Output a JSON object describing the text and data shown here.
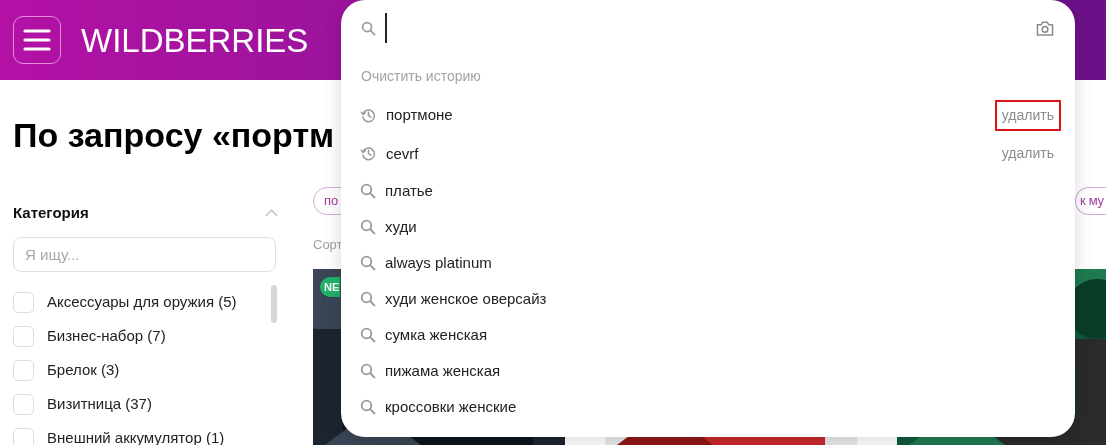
{
  "header": {
    "logo": "WILDBERRIES"
  },
  "page_title": "По запросу «портм",
  "filters": {
    "title": "Категория",
    "expanded": true,
    "search": {
      "placeholder": "Я ищу..."
    },
    "items": [
      {
        "label": "Аксессуары для оружия (5)",
        "checked": false
      },
      {
        "label": "Бизнес-набор (7)",
        "checked": false
      },
      {
        "label": "Брелок (3)",
        "checked": false
      },
      {
        "label": "Визитница (37)",
        "checked": false
      },
      {
        "label": "Внешний аккумулятор (1)",
        "checked": false
      }
    ]
  },
  "chips": [
    "по",
    "к му"
  ],
  "sort_label": "Сорт",
  "products": [
    {
      "kind": "picture",
      "badge": "NE"
    },
    {
      "kind": "picture"
    },
    {
      "kind": "picture"
    }
  ],
  "search_dropdown": {
    "clear_history": "Очистить историю",
    "items": [
      {
        "kind": "history",
        "text": "портмоне",
        "delete": "удалить",
        "highlighted": true
      },
      {
        "kind": "history",
        "text": "cevrf",
        "delete": "удалить",
        "highlighted": false
      },
      {
        "kind": "suggestion",
        "text": "платье"
      },
      {
        "kind": "suggestion",
        "text": "худи"
      },
      {
        "kind": "suggestion",
        "text": "always platinum"
      },
      {
        "kind": "suggestion",
        "text": "худи женское оверсайз"
      },
      {
        "kind": "suggestion",
        "text": "сумка женская"
      },
      {
        "kind": "suggestion",
        "text": "пижама женская"
      },
      {
        "kind": "suggestion",
        "text": "кроссовки женские"
      }
    ]
  }
}
